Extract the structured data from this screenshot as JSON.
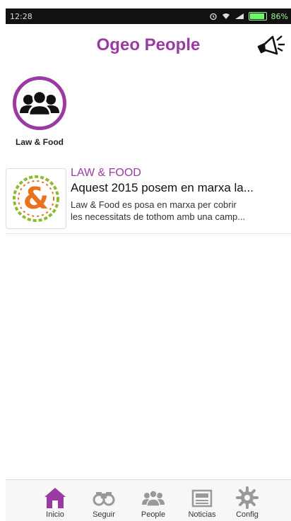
{
  "status_bar": {
    "time": "12:28",
    "battery": "86%"
  },
  "header": {
    "title": "Ogeo People",
    "megaphone_icon": "megaphone-icon"
  },
  "categories": [
    {
      "label": "Law & Food",
      "icon": "people-group-icon"
    }
  ],
  "news": [
    {
      "source": "LAW & FOOD",
      "title": "Aquest 2015 posem en marxa la...",
      "desc_line1": "Law & Food es posa en marxa per cobrir",
      "desc_line2": "les necessitats de tothom amb una camp..."
    }
  ],
  "nav": [
    {
      "label": "Inicio",
      "icon": "home-icon"
    },
    {
      "label": "Seguir",
      "icon": "binoculars-icon"
    },
    {
      "label": "People",
      "icon": "people-icon"
    },
    {
      "label": "Noticias",
      "icon": "newspaper-icon"
    },
    {
      "label": "Config",
      "icon": "gear-icon"
    }
  ],
  "colors": {
    "accent": "#9b3aa3",
    "logo_orange": "#e8731c",
    "logo_green": "#8dbb2f"
  }
}
